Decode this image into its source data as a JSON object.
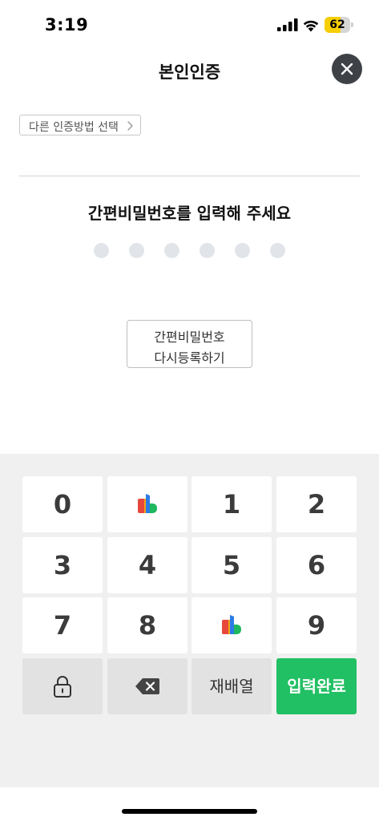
{
  "status_bar": {
    "time": "3:19",
    "battery_level": "62",
    "battery_fraction": 0.62,
    "battery_color": "#f7ce00"
  },
  "header": {
    "title": "본인인증",
    "close_icon": "close-icon"
  },
  "other_method": {
    "label": "다른 인증방법 선택",
    "icon": "chevron-right-icon"
  },
  "prompt": "간편비밀번호를 입력해 주세요",
  "pin": {
    "length": 6,
    "filled": 0
  },
  "reregister": {
    "line1": "간편비밀번호",
    "line2": "다시등록하기"
  },
  "keypad": {
    "rows": [
      [
        {
          "type": "digit",
          "label": "0"
        },
        {
          "type": "logo",
          "icon": "bank-logo-icon"
        },
        {
          "type": "digit",
          "label": "1"
        },
        {
          "type": "digit",
          "label": "2"
        }
      ],
      [
        {
          "type": "digit",
          "label": "3"
        },
        {
          "type": "digit",
          "label": "4"
        },
        {
          "type": "digit",
          "label": "5"
        },
        {
          "type": "digit",
          "label": "6"
        }
      ],
      [
        {
          "type": "digit",
          "label": "7"
        },
        {
          "type": "digit",
          "label": "8"
        },
        {
          "type": "logo",
          "icon": "bank-logo-icon"
        },
        {
          "type": "digit",
          "label": "9"
        }
      ]
    ],
    "lock_icon": "lock-icon",
    "backspace_icon": "backspace-icon",
    "shuffle_label": "재배열",
    "submit_label": "입력완료",
    "submit_color": "#22c064"
  }
}
